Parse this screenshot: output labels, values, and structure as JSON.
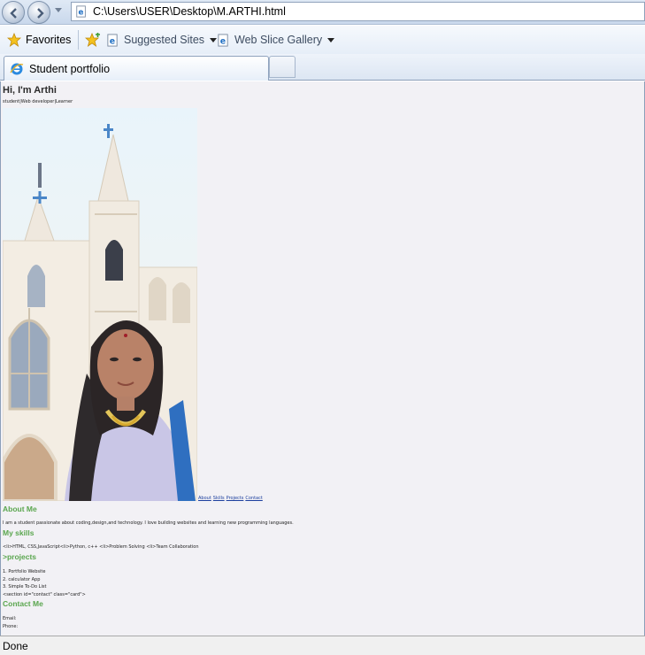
{
  "browser": {
    "address": "C:\\Users\\USER\\Desktop\\M.ARTHI.html",
    "favorites_label": "Favorites",
    "suggested_label": "Suggested Sites",
    "webslice_label": "Web Slice Gallery",
    "tab_title": "Student portfolio",
    "status": "Done"
  },
  "page": {
    "title": "Hi, I'm Arthi",
    "subtitle": "student|Web developer|Learner",
    "nav": [
      "About",
      "Skills",
      "Projects",
      "Contact"
    ],
    "about": {
      "heading": "About Me",
      "text": "I am a student passionate about coding,design,and technology. I love building websites and learning new programming languages."
    },
    "skills": {
      "heading": "My skills",
      "text": "<li>HTML, CSS,JavaScript<li>Python, c++ <li>Problem Solving <li>Team Collaboration"
    },
    "projects": {
      "heading": ">projects",
      "items": [
        "1. Portfolio Website",
        "2. calculator App",
        "3. Simple To-Do List",
        "<section id=\"contact\" class=\"card\">"
      ]
    },
    "contact": {
      "heading": "Contact Me",
      "email_label": "Email:",
      "phone_label": "Phone:"
    }
  }
}
